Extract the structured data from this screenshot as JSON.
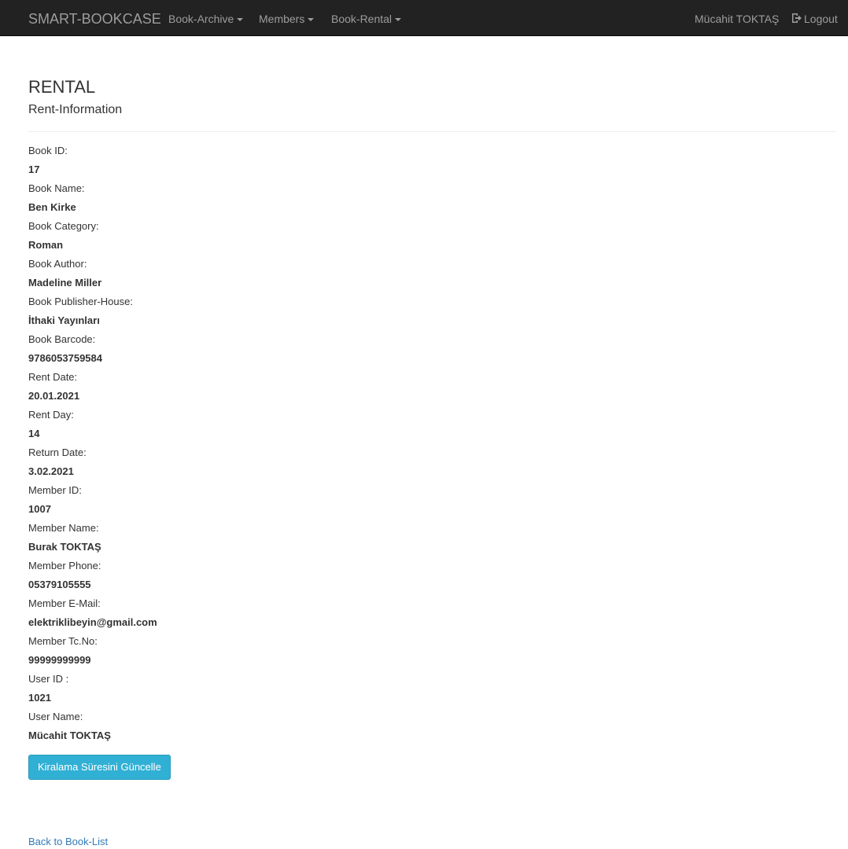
{
  "navbar": {
    "brand": "SMART-BOOKCASE",
    "menus": [
      {
        "label": "Book-Archive"
      },
      {
        "label": "Members"
      },
      {
        "label": "Book-Rental"
      }
    ],
    "user_name": "Mücahit TOKTAŞ",
    "logout_label": "Logout"
  },
  "page": {
    "title": "RENTAL",
    "subtitle": "Rent-Information"
  },
  "details": [
    {
      "label": "Book ID:",
      "value": "17"
    },
    {
      "label": "Book Name:",
      "value": "Ben Kirke"
    },
    {
      "label": "Book Category:",
      "value": "Roman"
    },
    {
      "label": "Book Author:",
      "value": "Madeline Miller"
    },
    {
      "label": "Book Publisher-House:",
      "value": "İthaki Yayınları"
    },
    {
      "label": "Book Barcode:",
      "value": "9786053759584"
    },
    {
      "label": "Rent Date:",
      "value": "20.01.2021"
    },
    {
      "label": "Rent Day:",
      "value": "14"
    },
    {
      "label": "Return Date:",
      "value": "3.02.2021"
    },
    {
      "label": "Member ID:",
      "value": "1007"
    },
    {
      "label": "Member Name:",
      "value": "Burak TOKTAŞ"
    },
    {
      "label": "Member Phone:",
      "value": "05379105555"
    },
    {
      "label": "Member E-Mail:",
      "value": "elektriklibeyin@gmail.com"
    },
    {
      "label": "Member Tc.No:",
      "value": "99999999999"
    },
    {
      "label": "User ID :",
      "value": "1021"
    },
    {
      "label": "User Name:",
      "value": "Mücahit TOKTAŞ"
    }
  ],
  "actions": {
    "update_button": "Kiralama Süresini Güncelle",
    "back_link": "Back to Book-List"
  },
  "colors": {
    "navbar_bg": "#222222",
    "nav_text": "#9d9d9d",
    "button_bg": "#31b0d5",
    "link": "#337ab7"
  },
  "icons": {
    "logout": "log-out-icon",
    "dropdown": "caret-down-icon"
  }
}
